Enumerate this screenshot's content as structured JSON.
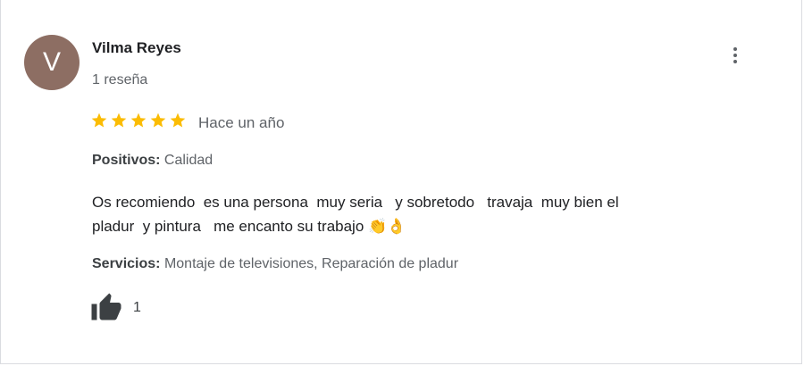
{
  "review": {
    "avatar_letter": "V",
    "avatar_color": "#8d6e63",
    "author": "Vilma Reyes",
    "review_count": "1 reseña",
    "rating": 5,
    "rating_max": 5,
    "star_color": "#fbbc04",
    "time": "Hace un año",
    "positives_label": "Positivos:",
    "positives_value": "Calidad",
    "text_line1": "Os recomiendo  es una persona  muy seria   y sobretodo   travaja  muy bien el",
    "text_line2": "pladur  y pintura   me encanto su trabajo ",
    "emoji": "👏👌",
    "services_label": "Servicios:",
    "services_value": "Montaje de televisiones, Reparación de pladur",
    "likes": "1",
    "more_icon": "more-vert-icon",
    "like_icon": "thumbs-up-icon"
  }
}
